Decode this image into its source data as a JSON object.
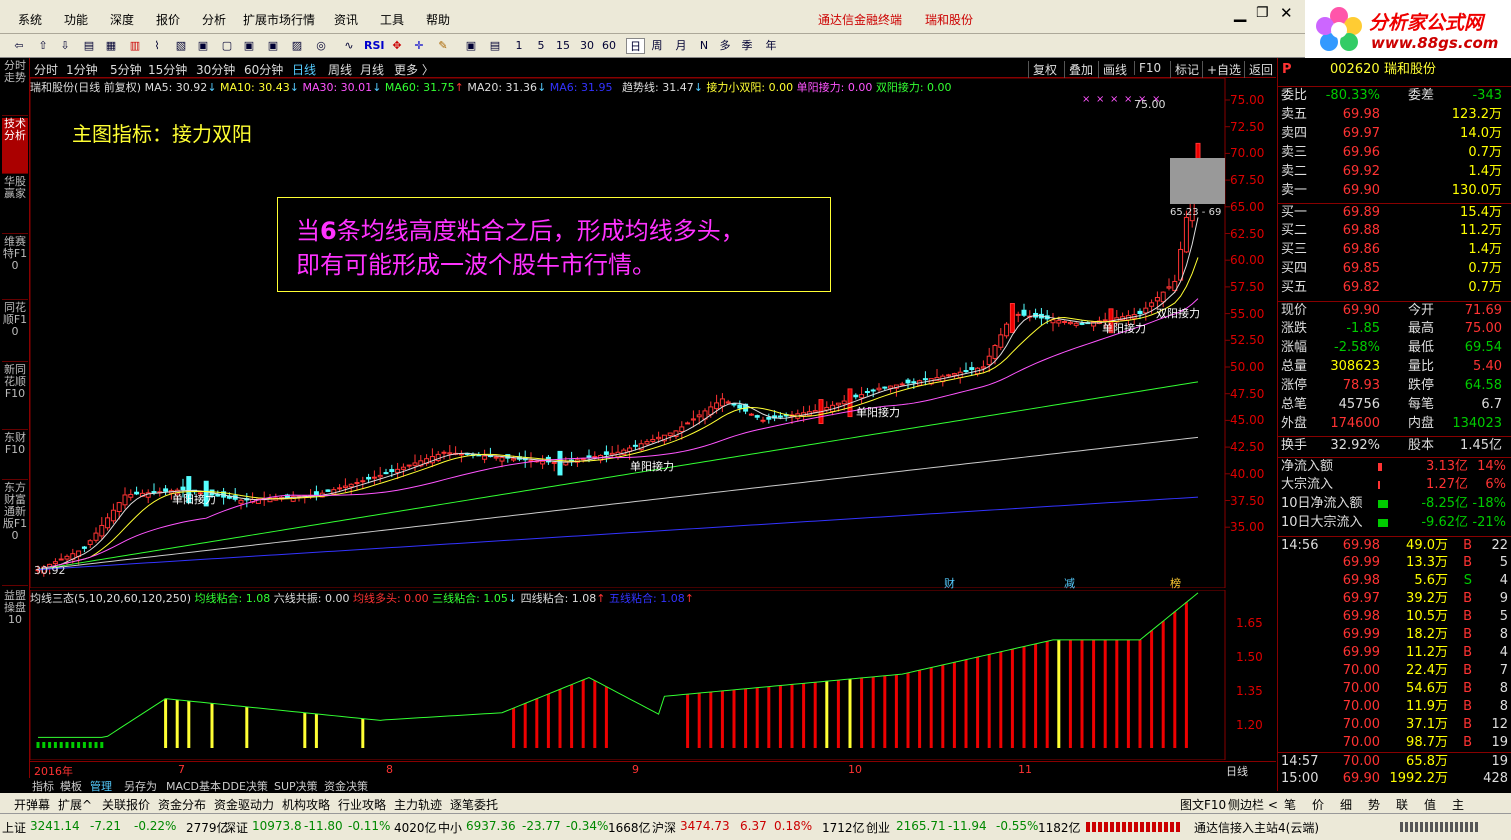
{
  "menu": [
    "系统",
    "功能",
    "深度",
    "报价",
    "分析",
    "扩展市场行情",
    "资讯",
    "工具",
    "帮助"
  ],
  "window_title": "通达信金融终端",
  "window_stock": "瑞和股份",
  "logo_text": "分析家公式网",
  "logo_url": "www.88gs.com",
  "toolbar_items": [
    "RSI",
    "1",
    "5",
    "15",
    "30",
    "60",
    "日",
    "周",
    "月",
    "N",
    "多",
    "季",
    "年"
  ],
  "left_tabs": [
    "分时走势",
    "技术分析",
    "华股赢家",
    "维赛特F10",
    "同花顺F10",
    "新同花顺F10",
    "东财F10",
    "东方财富通新版F10"
  ],
  "periods": [
    "分时",
    "1分钟",
    "5分钟",
    "15分钟",
    "30分钟",
    "60分钟",
    "日线",
    "周线",
    "月线",
    "更多 〉"
  ],
  "right_buttons": [
    "复权",
    "叠加",
    "画线",
    "F10",
    "标记",
    "+自选",
    "返回"
  ],
  "chart_header": {
    "name": "瑞和股份(日线 前复权)",
    "ma5": "MA5: 30.92",
    "ma10": "MA10: 30.43",
    "ma30": "MA30: 30.01",
    "ma60": "MA60: 31.75",
    "ma20": "MA20: 31.36",
    "ma6": "MA6: 31.95",
    "trend": "趋势线: 31.47",
    "relay_small": "接力小双阳: 0.00",
    "single_relay": "单阳接力: 0.00",
    "double_relay": "双阳接力: 0.00"
  },
  "main_indicator_title": "主图指标：接力双阳",
  "annotation_line1_prefix": "当",
  "annotation_line1_num": "6",
  "annotation_line1_rest": "条均线高度粘合之后，形成均线多头，",
  "annotation_line2": "即有可能形成一波个股牛市行情。",
  "labels": {
    "single_relay": "单阳接力",
    "double_relay": "双阳接力",
    "low": "30.92",
    "high": "75.00",
    "range": "65.23 - 69",
    "cai": "财",
    "jian": "减",
    "bang": "榜"
  },
  "y_axis_main": [
    "75.00",
    "72.50",
    "70.00",
    "67.50",
    "65.00",
    "62.50",
    "60.00",
    "57.50",
    "55.00",
    "52.50",
    "50.00",
    "47.50",
    "45.00",
    "42.50",
    "40.00",
    "37.50",
    "35.00"
  ],
  "y_axis_sub": [
    "1.65",
    "1.50",
    "1.35",
    "1.20"
  ],
  "sub_header": {
    "name": "均线三态(5,10,20,60,120,250)",
    "a": "均线粘合: 1.08",
    "b": "六线共振: 0.00",
    "c": "均线多头: 0.00",
    "d": "三线粘合: 1.05",
    "e": "四线粘合: 1.08",
    "f": "五线粘合: 1.08"
  },
  "sub_left_tab": "益盟操盘10",
  "x_axis": {
    "year": "2016年",
    "m7": "7",
    "m8": "8",
    "m9": "9",
    "m10": "10",
    "m11": "11",
    "period": "日线"
  },
  "bottom_tabs": [
    "指标",
    "模板",
    "管理",
    "另存为",
    "MACD基本",
    "DDE决策",
    "SUP决策",
    "资金决策"
  ],
  "func_bar": [
    "开弹幕",
    "扩展^",
    "关联报价",
    "资金分布",
    "资金驱动力",
    "机构攻略",
    "行业攻略",
    "主力轨迹",
    "逐笔委托"
  ],
  "func_right": [
    "图文F10",
    "侧边栏 <",
    "笔",
    "价",
    "细",
    "势",
    "联",
    "值",
    "主"
  ],
  "quote": {
    "code": "002620",
    "name": "瑞和股份",
    "webi_label": "委比",
    "webi": "-80.33%",
    "weicha_label": "委差",
    "weicha": "-343",
    "asks": [
      {
        "label": "卖五",
        "p": "69.98",
        "v": "123.2万"
      },
      {
        "label": "卖四",
        "p": "69.97",
        "v": "14.0万"
      },
      {
        "label": "卖三",
        "p": "69.96",
        "v": "0.7万"
      },
      {
        "label": "卖二",
        "p": "69.92",
        "v": "1.4万"
      },
      {
        "label": "卖一",
        "p": "69.90",
        "v": "130.0万"
      }
    ],
    "bids": [
      {
        "label": "买一",
        "p": "69.89",
        "v": "15.4万"
      },
      {
        "label": "买二",
        "p": "69.88",
        "v": "11.2万"
      },
      {
        "label": "买三",
        "p": "69.86",
        "v": "1.4万"
      },
      {
        "label": "买四",
        "p": "69.85",
        "v": "0.7万"
      },
      {
        "label": "买五",
        "p": "69.82",
        "v": "0.7万"
      }
    ],
    "stats": [
      {
        "l1": "现价",
        "v1": "69.90",
        "c1": "red",
        "l2": "今开",
        "v2": "71.69",
        "c2": "red"
      },
      {
        "l1": "涨跌",
        "v1": "-1.85",
        "c1": "green",
        "l2": "最高",
        "v2": "75.00",
        "c2": "red"
      },
      {
        "l1": "涨幅",
        "v1": "-2.58%",
        "c1": "green",
        "l2": "最低",
        "v2": "69.54",
        "c2": "green"
      },
      {
        "l1": "总量",
        "v1": "308623",
        "c1": "yellow",
        "l2": "量比",
        "v2": "5.40",
        "c2": "red"
      },
      {
        "l1": "涨停",
        "v1": "78.93",
        "c1": "red",
        "l2": "跌停",
        "v2": "64.58",
        "c2": "green"
      },
      {
        "l1": "总笔",
        "v1": "45756",
        "c1": "white",
        "l2": "每笔",
        "v2": "6.7",
        "c2": "white"
      },
      {
        "l1": "外盘",
        "v1": "174600",
        "c1": "red",
        "l2": "内盘",
        "v2": "134023",
        "c2": "green"
      }
    ],
    "turnover_label": "换手",
    "turnover": "32.92%",
    "equity_label": "股本",
    "equity": "1.45亿",
    "flows": [
      {
        "l": "净流入额",
        "v": "3.13亿",
        "p": "14%",
        "c": "red"
      },
      {
        "l": "大宗流入",
        "v": "1.27亿",
        "p": "6%",
        "c": "red"
      },
      {
        "l": "10日净流入额",
        "v": "-8.25亿",
        "p": "-18%",
        "c": "green"
      },
      {
        "l": "10日大宗流入",
        "v": "-9.62亿",
        "p": "-21%",
        "c": "green"
      }
    ],
    "ticks": [
      {
        "t": "14:56",
        "p": "69.98",
        "v": "49.0万",
        "d": "B",
        "n": "22"
      },
      {
        "t": "",
        "p": "69.99",
        "v": "13.3万",
        "d": "B",
        "n": "5"
      },
      {
        "t": "",
        "p": "69.98",
        "v": "5.6万",
        "d": "S",
        "n": "4"
      },
      {
        "t": "",
        "p": "69.97",
        "v": "39.2万",
        "d": "B",
        "n": "9"
      },
      {
        "t": "",
        "p": "69.98",
        "v": "10.5万",
        "d": "B",
        "n": "5"
      },
      {
        "t": "",
        "p": "69.99",
        "v": "18.2万",
        "d": "B",
        "n": "8"
      },
      {
        "t": "",
        "p": "69.99",
        "v": "11.2万",
        "d": "B",
        "n": "4"
      },
      {
        "t": "",
        "p": "70.00",
        "v": "22.4万",
        "d": "B",
        "n": "7"
      },
      {
        "t": "",
        "p": "70.00",
        "v": "54.6万",
        "d": "B",
        "n": "8"
      },
      {
        "t": "",
        "p": "70.00",
        "v": "11.9万",
        "d": "B",
        "n": "8"
      },
      {
        "t": "",
        "p": "70.00",
        "v": "37.1万",
        "d": "B",
        "n": "12"
      },
      {
        "t": "",
        "p": "70.00",
        "v": "98.7万",
        "d": "B",
        "n": "19"
      },
      {
        "t": "14:57",
        "p": "70.00",
        "v": "65.8万",
        "d": "",
        "n": "19"
      },
      {
        "t": "15:00",
        "p": "69.90",
        "v": "1992.2万",
        "d": "",
        "n": "428"
      }
    ]
  },
  "status": {
    "sh_label": "上证",
    "sh": "3241.14",
    "sh_chg": "-7.21",
    "sh_pct": "-0.22%",
    "sh_amt": "2779亿",
    "sz_label": "深证",
    "sz": "10973.8",
    "sz_chg": "-11.80",
    "sz_pct": "-0.11%",
    "sz_amt": "4020亿",
    "zx_label": "中小",
    "zx": "6937.36",
    "zx_chg": "-23.77",
    "zx_pct": "-0.34%",
    "zx_amt": "1668亿",
    "hs_label": "沪深",
    "hs": "3474.73",
    "hs_chg": "6.37",
    "hs_pct": "0.18%",
    "hs_amt": "1712亿",
    "cy_label": "创业",
    "cy": "2165.71",
    "cy_chg": "-11.94",
    "cy_pct": "-0.55%",
    "cy_amt": "1182亿",
    "server": "通达信接入主站4(云端)"
  }
}
